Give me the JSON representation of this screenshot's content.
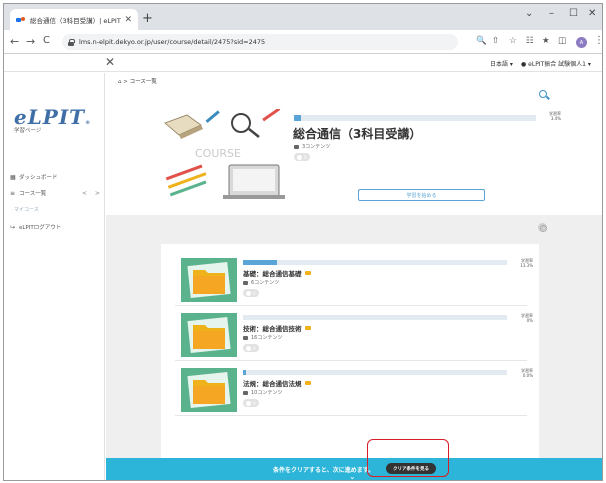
{
  "browser": {
    "tab_title": "総合通信（3科目受講）| eLPIT",
    "new_tab_glyph": "+",
    "tab_close_glyph": "✕",
    "url": "lms.n-elpit.dekyo.or.jp/user/course/detail/2475?sid=2475",
    "window_controls": {
      "chevron": "⌄",
      "minimize": "–",
      "maximize": "☐",
      "close": "✕"
    },
    "nav": {
      "back": "←",
      "forward": "→",
      "reload": "C"
    },
    "profile_initial": "A",
    "menu_dots": "⋮",
    "toolbar_icons": [
      "🔍",
      "⇧",
      "☆",
      "☷",
      "★",
      "◫"
    ]
  },
  "header": {
    "close_glyph": "✕",
    "language": "日本語 ▾",
    "user": "eLPIT振合 試験個人1 ▾"
  },
  "sidebar": {
    "logo": "eLPIT",
    "logo_mark": "®",
    "logo_sub": "学習ページ",
    "items": [
      {
        "label": "ダッシュボード",
        "icon": "dashboard-icon"
      },
      {
        "label": "コース一覧",
        "icon": "list-icon"
      },
      {
        "label": "eLPITログアウト",
        "icon": "logout-icon"
      }
    ],
    "arrows": "< >",
    "sub_link": "マイコース"
  },
  "main": {
    "breadcrumb": "⌂ > コース一覧",
    "hero_word": "COURSE",
    "course": {
      "title": "総合通信（3科目受講）",
      "progress_pct": 3,
      "pct_label_top": "学習率",
      "pct_label_bottom": "3.4%",
      "contents_label": "3コンテンツ",
      "pill_count": "0"
    },
    "apply_button": "学習を始める"
  },
  "lessons": [
    {
      "title": "基礎：総合通信基礎",
      "progress_pct": 13,
      "pct_label_top": "学習率",
      "pct_label_bottom": "13.3%",
      "contents_label": "6コンテンツ",
      "pill_count": "0"
    },
    {
      "title": "技術：総合通信技術",
      "progress_pct": 0,
      "pct_label_top": "学習率",
      "pct_label_bottom": "0%",
      "contents_label": "16コンテンツ",
      "pill_count": "0"
    },
    {
      "title": "法規：総合通信法規",
      "progress_pct": 1,
      "pct_label_top": "学習率",
      "pct_label_bottom": "0.0%",
      "contents_label": "10コンテンツ",
      "pill_count": "0"
    }
  ],
  "footer": {
    "message": "条件をクリアすると、次に進めます。",
    "button": "クリア条件を見る",
    "chevron": "⌄"
  },
  "colors": {
    "accent": "#2cb5d8",
    "progress": "#5aa5d8",
    "highlight": "#d61f26",
    "logo": "#3f6fa6",
    "thumb": "#5bb38e",
    "folder": "#f0b21b"
  }
}
